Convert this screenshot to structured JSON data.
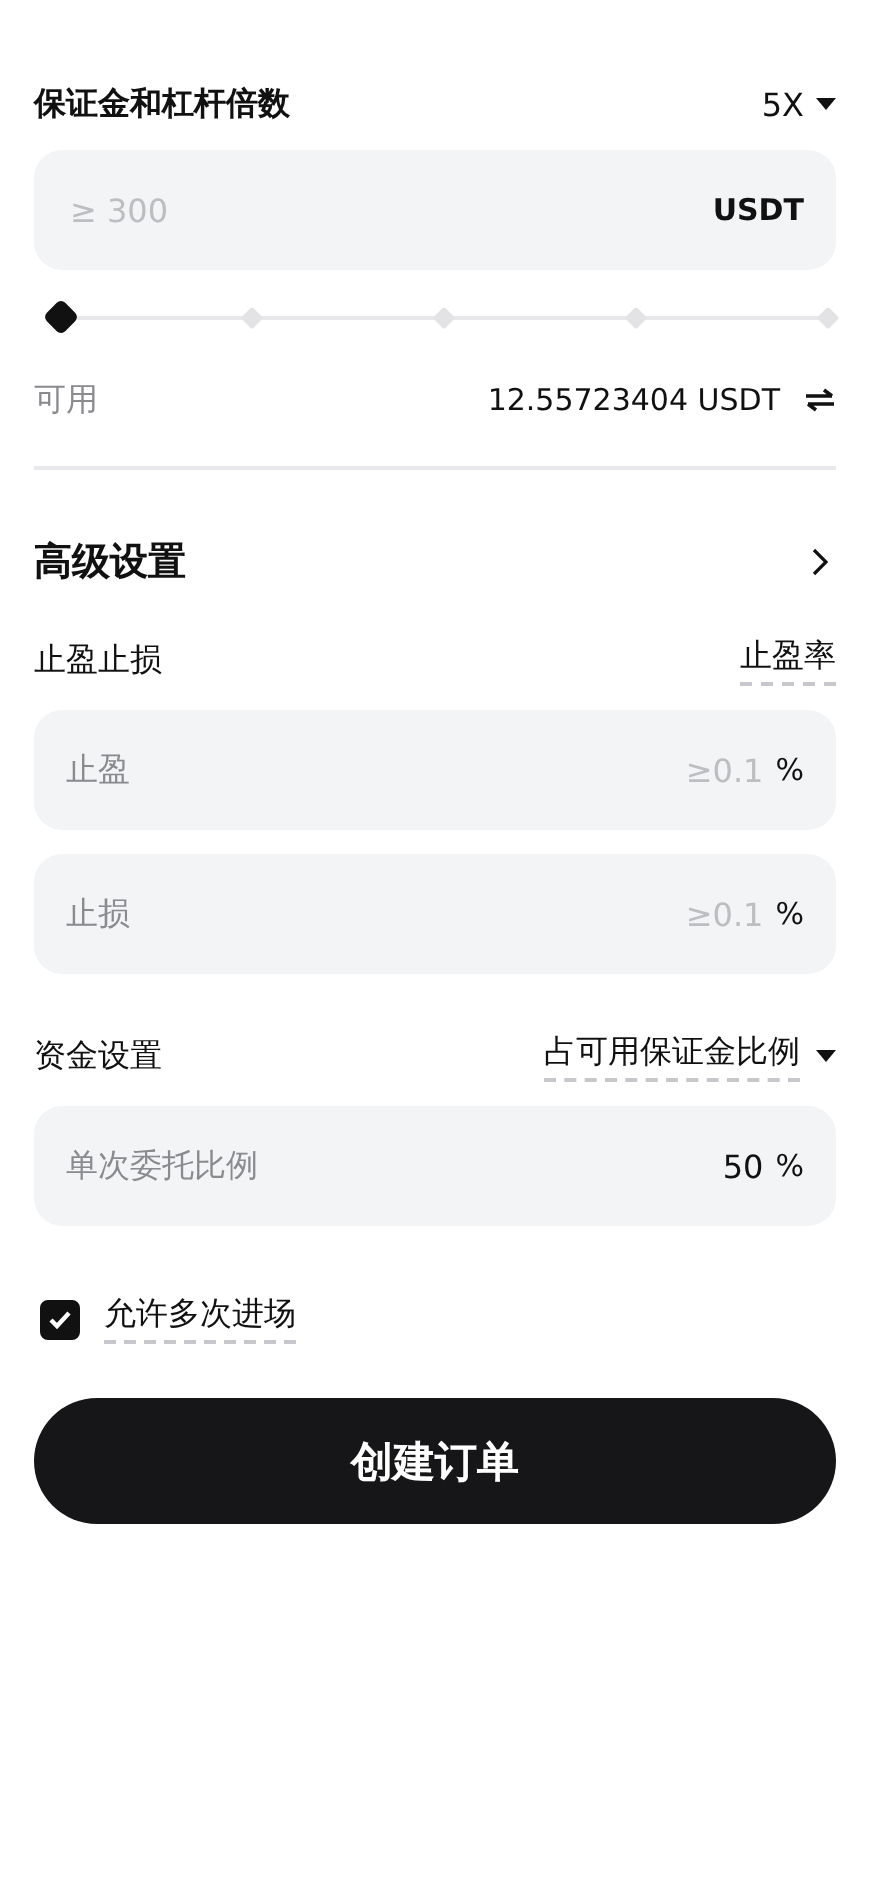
{
  "margin": {
    "label": "保证金和杠杆倍数",
    "leverage": "5X",
    "placeholder": "≥ 300",
    "unit": "USDT"
  },
  "slider": {
    "level": 0
  },
  "available": {
    "label": "可用",
    "value": "12.55723404 USDT"
  },
  "advanced": {
    "title": "高级设置"
  },
  "tpsl": {
    "label": "止盈止损",
    "mode": "止盈率",
    "fields": [
      {
        "label": "止盈",
        "placeholder": "≥0.1",
        "unit": "%"
      },
      {
        "label": "止损",
        "placeholder": "≥0.1",
        "unit": "%"
      }
    ]
  },
  "funds": {
    "label": "资金设置",
    "mode": "占可用保证金比例",
    "field": {
      "label": "单次委托比例",
      "value": "50",
      "unit": "%"
    }
  },
  "multi_entry": {
    "label": "允许多次进场",
    "checked": true
  },
  "submit": "创建订单"
}
